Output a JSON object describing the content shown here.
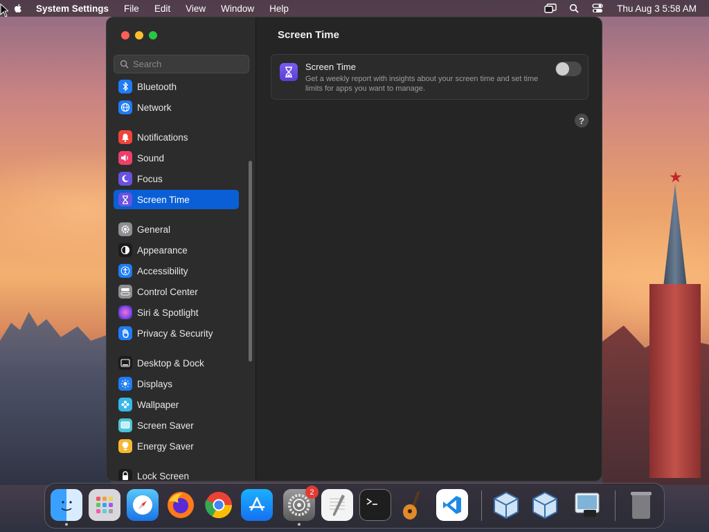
{
  "menubar": {
    "app_name": "System Settings",
    "menus": [
      "File",
      "Edit",
      "View",
      "Window",
      "Help"
    ],
    "clock": "Thu Aug 3  5:58 AM"
  },
  "sidebar": {
    "search_placeholder": "Search",
    "items": [
      {
        "label": "Bluetooth",
        "icon": "bluetooth-icon",
        "color": "#1f7cf4"
      },
      {
        "label": "Network",
        "icon": "globe-icon",
        "color": "#1f7cf4"
      },
      {
        "label": "Notifications",
        "icon": "bell-icon",
        "color": "#f0443b"
      },
      {
        "label": "Sound",
        "icon": "speaker-icon",
        "color": "#f03e6a"
      },
      {
        "label": "Focus",
        "icon": "moon-icon",
        "color": "#6a52e0"
      },
      {
        "label": "Screen Time",
        "icon": "hourglass-icon",
        "color": "#6a52e0",
        "selected": true
      },
      {
        "label": "General",
        "icon": "gear-icon",
        "color": "#8e8e93"
      },
      {
        "label": "Appearance",
        "icon": "appearance-icon",
        "color": "#1c1c1e"
      },
      {
        "label": "Accessibility",
        "icon": "accessibility-icon",
        "color": "#1f7cf4"
      },
      {
        "label": "Control Center",
        "icon": "control-center-icon",
        "color": "#8e8e93"
      },
      {
        "label": "Siri & Spotlight",
        "icon": "siri-icon",
        "color": "#b14ad0"
      },
      {
        "label": "Privacy & Security",
        "icon": "hand-icon",
        "color": "#1f7cf4"
      },
      {
        "label": "Desktop & Dock",
        "icon": "dock-icon",
        "color": "#1c1c1e"
      },
      {
        "label": "Displays",
        "icon": "sun-icon",
        "color": "#1f7cf4"
      },
      {
        "label": "Wallpaper",
        "icon": "flower-icon",
        "color": "#35b8e8"
      },
      {
        "label": "Screen Saver",
        "icon": "screensaver-icon",
        "color": "#4fc3d8"
      },
      {
        "label": "Energy Saver",
        "icon": "bulb-icon",
        "color": "#f5b82e"
      },
      {
        "label": "Lock Screen",
        "icon": "lock-icon",
        "color": "#1c1c1e"
      }
    ]
  },
  "content": {
    "title": "Screen Time",
    "card": {
      "title": "Screen Time",
      "description": "Get a weekly report with insights about your screen time and set time limits for apps you want to manage.",
      "toggle_on": false
    },
    "help": "?"
  },
  "dock": {
    "apps": [
      "Finder",
      "Launchpad",
      "Safari",
      "Firefox",
      "Chrome",
      "App Store",
      "System Settings",
      "TextEdit",
      "Terminal",
      "GarageBand",
      "Visual Studio Code",
      "VirtualBox",
      "VirtualBox VM",
      "Preview",
      "Trash"
    ],
    "settings_badge": "2"
  }
}
